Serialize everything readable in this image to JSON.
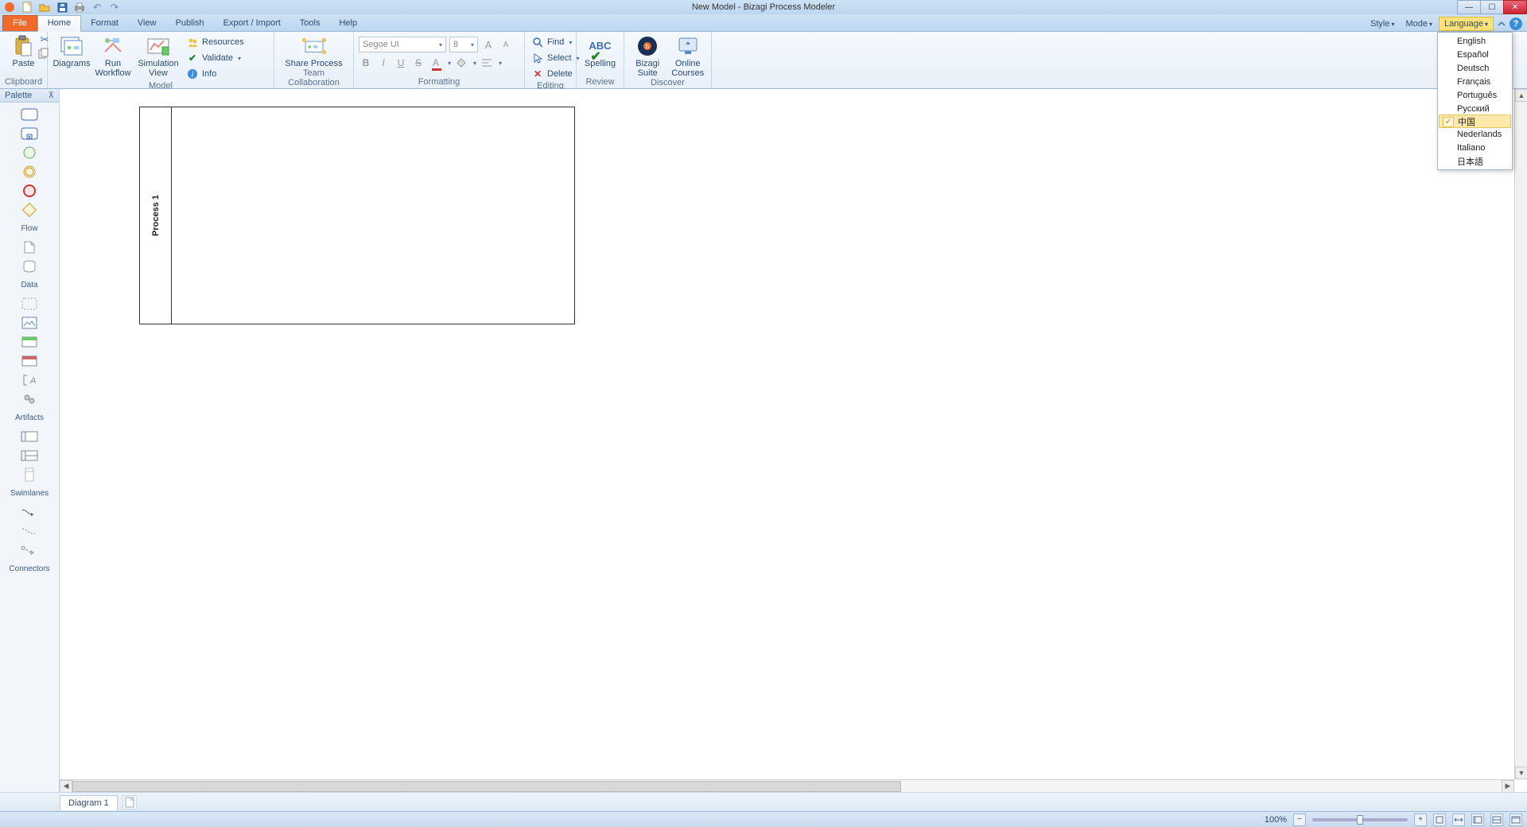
{
  "title": "New Model - Bizagi Process Modeler",
  "tabs": {
    "file": "File",
    "home": "Home",
    "format": "Format",
    "view": "View",
    "publish": "Publish",
    "export": "Export / Import",
    "tools": "Tools",
    "help": "Help"
  },
  "ribbonRight": {
    "style": "Style",
    "mode": "Mode",
    "language": "Language"
  },
  "ribbon": {
    "clipboard": {
      "label": "Clipboard",
      "paste": "Paste"
    },
    "model": {
      "label": "Model",
      "diagrams": "Diagrams",
      "runWorkflow": "Run\nWorkflow",
      "simulationView": "Simulation\nView",
      "resources": "Resources",
      "validate": "Validate",
      "info": "Info"
    },
    "team": {
      "label": "Team Collaboration",
      "share": "Share Process"
    },
    "formatting": {
      "label": "Formatting",
      "font": "Segoe UI",
      "size": "8"
    },
    "editing": {
      "label": "Editing",
      "find": "Find",
      "select": "Select",
      "delete": "Delete"
    },
    "review": {
      "label": "Review",
      "spelling": "Spelling"
    },
    "discover": {
      "label": "Discover",
      "suite": "Bizagi Suite",
      "courses": "Online\nCourses"
    }
  },
  "palette": {
    "title": "Palette",
    "flow": "Flow",
    "data": "Data",
    "artifacts": "Artifacts",
    "swimlanes": "Swimlanes",
    "connectors": "Connectors"
  },
  "canvas": {
    "poolName": "Process 1"
  },
  "diagTabs": {
    "d1": "Diagram 1"
  },
  "status": {
    "zoom": "100%"
  },
  "languages": [
    "English",
    "Español",
    "Deutsch",
    "Français",
    "Português",
    "Русский",
    "中国",
    "Nederlands",
    "Italiano",
    "日本語"
  ],
  "languageSelectedIndex": 6
}
